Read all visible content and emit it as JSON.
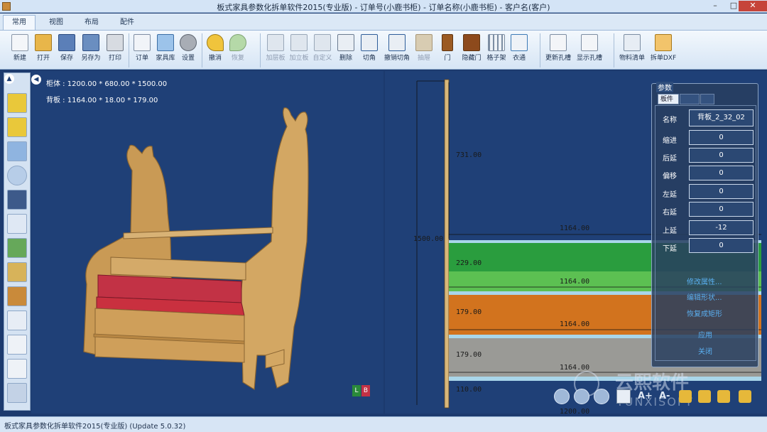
{
  "window": {
    "title": "板式家具参数化拆单软件2015(专业版) - 订单号(小鹿书柜) - 订单名称(小鹿书柜) - 客户名(客户)"
  },
  "tabs": [
    "常用",
    "视图",
    "布局",
    "配件"
  ],
  "ribbon": {
    "group1": [
      "新建",
      "打开",
      "保存",
      "另存为",
      "打印"
    ],
    "group2": [
      "订单",
      "家具库",
      "设置"
    ],
    "group3": [
      "撤消",
      "恢复"
    ],
    "group4": [
      "加层板",
      "加立板",
      "自定义",
      "删除",
      "切角",
      "撤销切角",
      "抽屉",
      "门",
      "隐藏门",
      "格子架",
      "衣通"
    ],
    "group5": [
      "更新孔槽",
      "显示孔槽"
    ],
    "group6": [
      "物料清单",
      "拆单DXF"
    ]
  },
  "view3d": {
    "cabinet": "柜体 : 1200.00 * 680.00 * 1500.00",
    "backboard": "背板 : 1164.00 * 18.00 * 179.00",
    "colors": {
      "wood": "#c99a55",
      "red": "#c23245"
    }
  },
  "view2d": {
    "dims": [
      "731.00",
      "1500.00",
      "1164.00",
      "229.00",
      "1164.00",
      "179.00",
      "1164.00",
      "179.00",
      "1164.00",
      "110.00",
      "1200.00"
    ],
    "colors": {
      "green": "#2a9d3e",
      "lightgreen": "#5cc052",
      "orange": "#d2731e",
      "gray": "#9a9a96"
    }
  },
  "params": {
    "title": "参数",
    "tabs": [
      "板件",
      "",
      ""
    ],
    "rows": [
      {
        "label": "名称",
        "value": "背板_2_32_02"
      },
      {
        "label": "缩进",
        "value": "0"
      },
      {
        "label": "后延",
        "value": "0"
      },
      {
        "label": "偏移",
        "value": "0"
      },
      {
        "label": "左延",
        "value": "0"
      },
      {
        "label": "右延",
        "value": "0"
      },
      {
        "label": "上延",
        "value": "-12"
      },
      {
        "label": "下延",
        "value": "0"
      }
    ],
    "links": [
      "修改属性...",
      "编辑形状...",
      "恢复成矩形",
      "应用",
      "关闭"
    ]
  },
  "watermark": {
    "cn": "云熙软件",
    "en": "YUNXISOFT"
  },
  "status": "板式家具参数化拆单软件2015(专业版) (Update 5.0.32)"
}
